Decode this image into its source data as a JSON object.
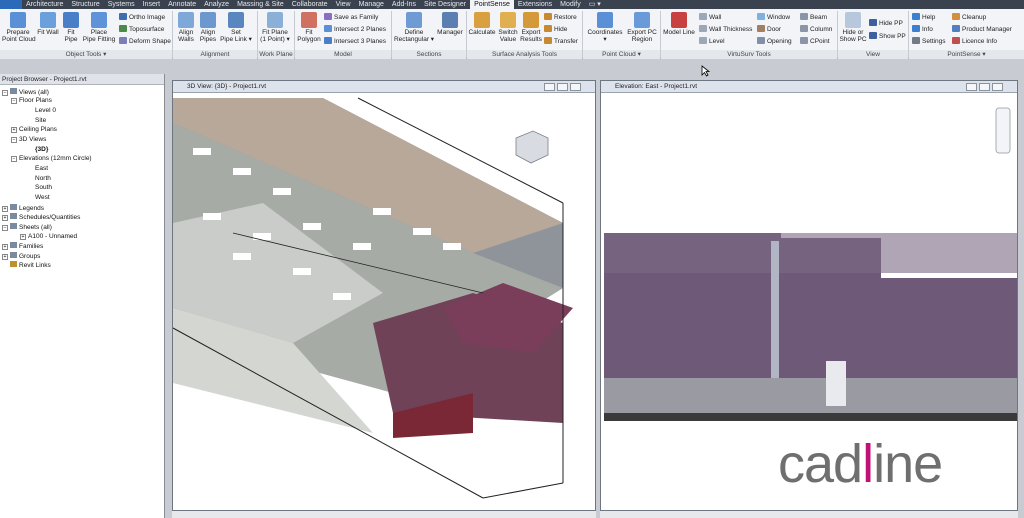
{
  "ribbon_tabs": [
    "Architecture",
    "Structure",
    "Systems",
    "Insert",
    "Annotate",
    "Analyze",
    "Massing & Site",
    "Collaborate",
    "View",
    "Manage",
    "Add-Ins",
    "Site Designer",
    "PointSense",
    "Extensions",
    "Modify"
  ],
  "groups": {
    "object_tools": "Object Tools ▾",
    "alignment": "Alignment",
    "work_plane": "Work Plane",
    "model": "Model",
    "sections": "Sections",
    "surface": "Surface Analysis Tools",
    "point_cloud": "Point Cloud ▾",
    "virtusurv": "VirtuSurv Tools",
    "view": "View",
    "pointsense": "PointSense ▾"
  },
  "buttons": {
    "prepare_line1": "Prepare",
    "prepare_line2": "Point Cloud",
    "fit_wall": "Fit Wall",
    "fit_pipe_line1": "Fit",
    "fit_pipe_line2": "Pipe",
    "place_pipe_line1": "Place",
    "place_pipe_line2": "Pipe Fitting",
    "ortho_image": "Ortho Image",
    "toposurface": "Toposurface",
    "deform_shape": "Deform Shape",
    "align_walls_line1": "Align",
    "align_walls_line2": "Walls",
    "align_pipes_line1": "Align",
    "align_pipes_line2": "Pipes",
    "set_pipe_line1": "Set",
    "set_pipe_line2": "Pipe Link ▾",
    "fit_plane_line1": "Fit Plane",
    "fit_plane_line2": "(1 Point) ▾",
    "fit_polygon_line1": "Fit",
    "fit_polygon_line2": "Polygon",
    "save_family": "Save as Family",
    "intersect2": "Intersect 2 Planes",
    "intersect3": "Intersect 3 Planes",
    "define_rect_line1": "Define",
    "define_rect_line2": "Rectangular ▾",
    "manager": "Manager",
    "calculate": "Calculate",
    "switch_line1": "Switch",
    "switch_line2": "Value",
    "export_results_line1": "Export",
    "export_results_line2": "Results",
    "restore": "Restore",
    "hide": "Hide",
    "transfer": "Transfer",
    "coordinates_line1": "Coordinates",
    "coordinates_line2": "▾",
    "export_pc_line1": "Export PC",
    "export_pc_line2": "Region",
    "model_line": "Model Line",
    "wall": "Wall",
    "wall_thickness": "Wall Thickness",
    "level": "Level",
    "window": "Window",
    "door": "Door",
    "opening": "Opening",
    "beam": "Beam",
    "column": "Column",
    "cpoint": "CPoint",
    "hide_show_line1": "Hide or",
    "hide_show_line2": "Show PC",
    "hide_pp": "Hide PP",
    "show_pp": "Show PP",
    "help": "Help",
    "info": "Info",
    "settings": "Settings",
    "cleanup": "Cleanup",
    "product_manager": "Product Manager",
    "licence_info": "Licence Info"
  },
  "project_browser": {
    "title": "Project Browser - Project1.rvt",
    "items": [
      "Views (all)",
      "Floor Plans",
      "Level 0",
      "Site",
      "Ceiling Plans",
      "3D Views",
      "{3D}",
      "Elevations (12mm Circle)",
      "East",
      "North",
      "South",
      "West",
      "Legends",
      "Schedules/Quantities",
      "Sheets (all)",
      "A100 - Unnamed",
      "Families",
      "Groups",
      "Revit Links"
    ]
  },
  "view3d": {
    "title": "3D View: {3D} - Project1.rvt"
  },
  "elevation": {
    "title": "Elevation: East - Project1.rvt"
  },
  "watermark": {
    "pre": "cad",
    "i": "l",
    "post": "ine"
  },
  "colors": {
    "ribbon_bg": "#f2f4f7",
    "tab_bar": "#3a4250",
    "active_tab": "#f2f4f7",
    "logo_accent": "#c0117a"
  }
}
